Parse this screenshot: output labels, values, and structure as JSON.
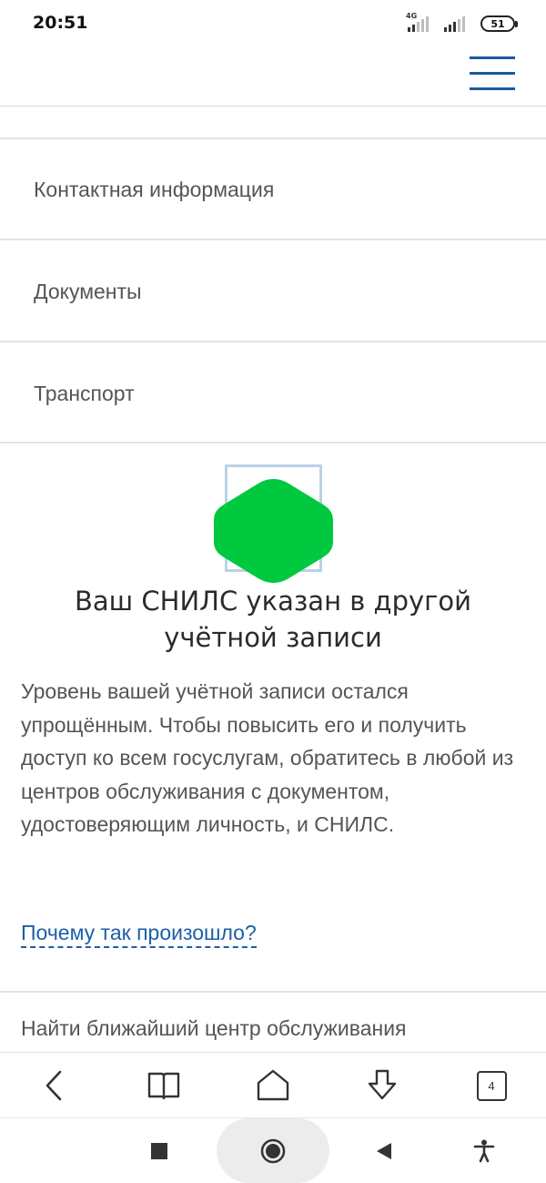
{
  "status_bar": {
    "time": "20:51",
    "network": "4G",
    "battery": "51"
  },
  "menu": {
    "items": [
      {
        "label": "Контактная информация"
      },
      {
        "label": "Документы"
      },
      {
        "label": "Транспорт"
      }
    ]
  },
  "message": {
    "title": "Ваш СНИЛС указан в другой учётной записи",
    "description": "Уровень вашей учётной записи остался упрощённым. Чтобы повысить его и получить доступ ко всем госуслугам, обратитесь в любой из центров обслуживания с документом, удостоверяющим личность, и СНИЛС.",
    "why_link": "Почему так произошло?",
    "find_center": "Найти ближайший центр обслуживания"
  },
  "browser_toolbar": {
    "tabs_count": "4",
    "icons": [
      "back-icon",
      "bookmarks-icon",
      "home-icon",
      "download-icon",
      "tabs-icon"
    ]
  },
  "system_nav": {
    "icons": [
      "recents-icon",
      "home-circle-icon",
      "back-triangle-icon",
      "accessibility-icon"
    ]
  },
  "colors": {
    "accent": "#1a5a9e",
    "link": "#1d5fa8",
    "overlay_green": "#00c93f"
  }
}
